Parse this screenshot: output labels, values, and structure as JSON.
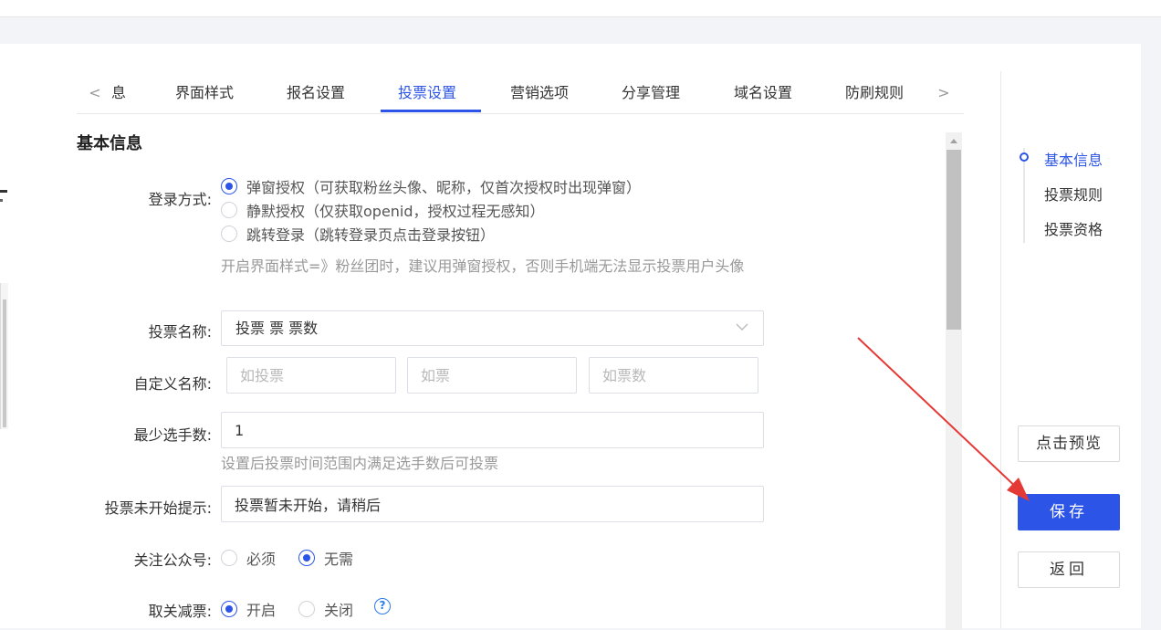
{
  "tabs": {
    "prev_arrow": "<",
    "next_arrow": ">",
    "items": [
      {
        "label": "息"
      },
      {
        "label": "界面样式"
      },
      {
        "label": "报名设置"
      },
      {
        "label": "投票设置"
      },
      {
        "label": "营销选项"
      },
      {
        "label": "分享管理"
      },
      {
        "label": "域名设置"
      },
      {
        "label": "防刷规则"
      }
    ],
    "active_index": 3
  },
  "section_title": "基本信息",
  "form": {
    "login": {
      "label": "登录方式:",
      "options": [
        {
          "label": "弹窗授权（可获取粉丝头像、昵称，仅首次授权时出现弹窗）",
          "checked": true
        },
        {
          "label": "静默授权（仅获取openid，授权过程无感知）",
          "checked": false
        },
        {
          "label": "跳转登录（跳转登录页点击登录按钮）",
          "checked": false
        }
      ],
      "hint": "开启界面样式=》粉丝团时，建议用弹窗授权，否则手机端无法显示投票用户头像"
    },
    "vote_name": {
      "label": "投票名称:",
      "value": "投票 票 票数"
    },
    "custom_name": {
      "label": "自定义名称:",
      "placeholders": [
        "如投票",
        "如票",
        "如票数"
      ]
    },
    "min_players": {
      "label": "最少选手数:",
      "value": "1",
      "hint": "设置后投票时间范围内满足选手数后可投票"
    },
    "not_started": {
      "label": "投票未开始提示:",
      "value": "投票暂未开始，请稍后"
    },
    "follow": {
      "label": "关注公众号:",
      "options": [
        {
          "label": "必须",
          "checked": false
        },
        {
          "label": "无需",
          "checked": true
        }
      ]
    },
    "unfollow_reduce": {
      "label": "取关减票:",
      "options": [
        {
          "label": "开启",
          "checked": true
        },
        {
          "label": "关闭",
          "checked": false
        }
      ],
      "help": "?"
    }
  },
  "anchor": {
    "items": [
      {
        "label": "基本信息"
      },
      {
        "label": "投票规则"
      },
      {
        "label": "投票资格"
      }
    ],
    "active_index": 0
  },
  "actions": {
    "preview": "点击预览",
    "save": "保存",
    "back": "返回"
  },
  "colors": {
    "primary": "#2c55e8",
    "annotation_arrow": "#e53935"
  },
  "icons": {
    "select_arrow": "chevron-down-icon",
    "help": "question-circle-icon",
    "annotation": "red-arrow-annotation"
  }
}
